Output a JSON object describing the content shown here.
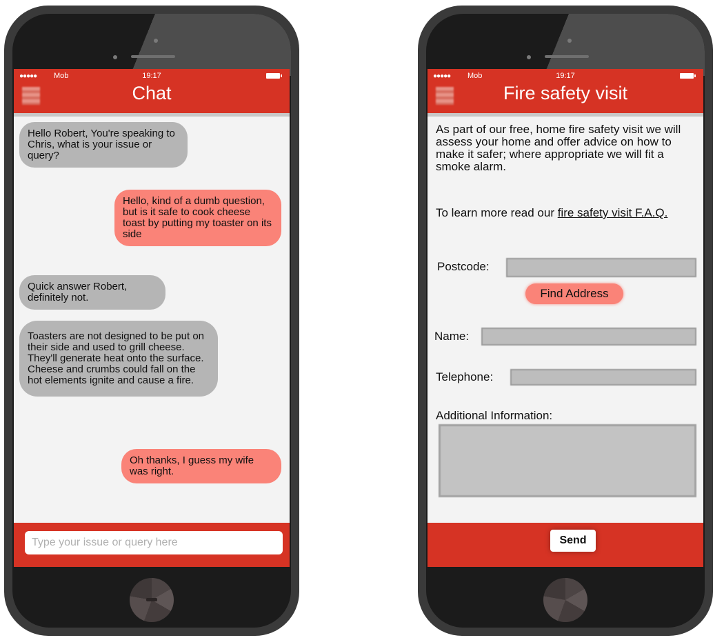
{
  "left_phone": {
    "status": {
      "signal": "●●●●●",
      "carrier": "Mob",
      "time": "19:17"
    },
    "title": "Chat",
    "messages": [
      {
        "from": "agent",
        "text": "Hello Robert, You're speaking to Chris, what is your issue or query?"
      },
      {
        "from": "user",
        "text": "Hello, kind of a dumb question, but is it safe to cook cheese toast by putting my toaster on its side"
      },
      {
        "from": "agent",
        "text": "Quick answer Robert, definitely not."
      },
      {
        "from": "agent",
        "text": "Toasters are not designed  to be put on their side and used to grill cheese. They'll generate heat onto the surface. Cheese and crumbs could fall on the hot elements ignite and cause a fire."
      },
      {
        "from": "user",
        "text": "Oh thanks,  I guess my wife was right."
      }
    ],
    "input_placeholder": "Type your issue or query here"
  },
  "right_phone": {
    "status": {
      "signal": "●●●●●",
      "carrier": "Mob",
      "time": "19:17"
    },
    "title": "Fire safety visit",
    "intro": "As part of our free, home fire safety visit we will assess your home and offer advice on how to make it safer; where appropriate we will fit a smoke alarm.",
    "faq_prefix": "To learn more read our ",
    "faq_link": "fire safety visit F.A.Q.",
    "postcode_label": "Postcode:",
    "find_address": "Find Address",
    "name_label": "Name:",
    "telephone_label": "Telephone:",
    "additional_label": "Additional Information:",
    "send": "Send"
  },
  "colors": {
    "brand_red": "#d63324",
    "user_bubble": "#fa8378",
    "agent_bubble": "#b5b5b5"
  }
}
